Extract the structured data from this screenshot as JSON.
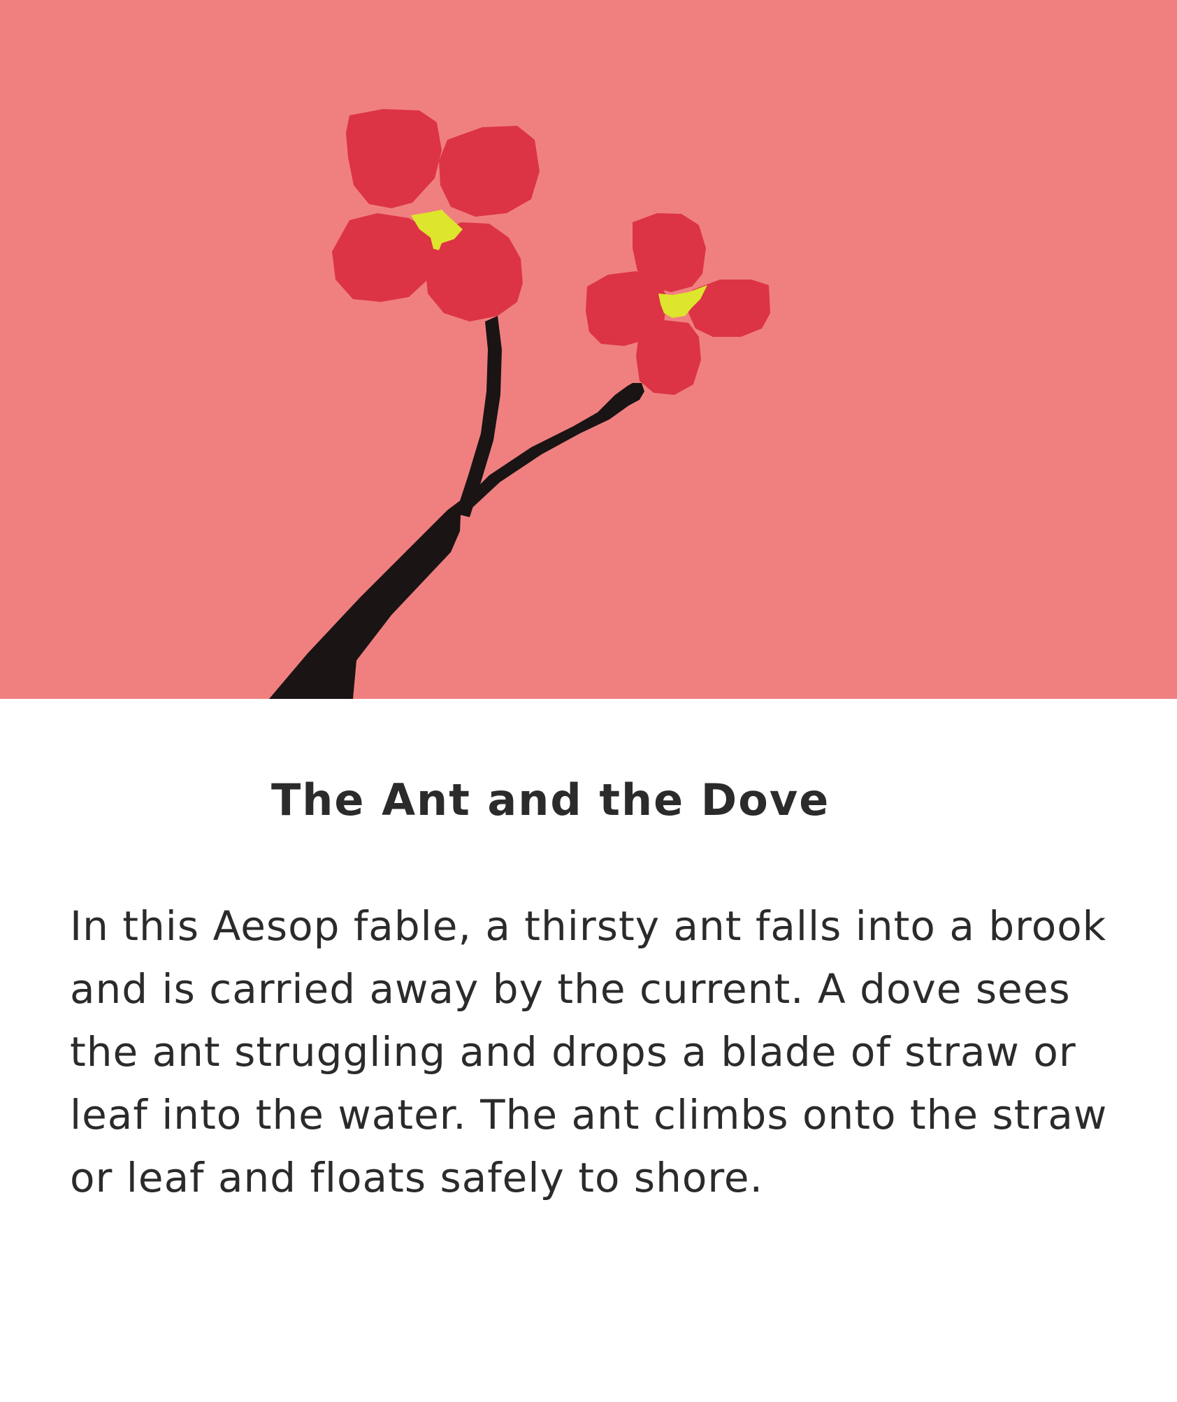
{
  "page": {
    "background_color": "#ffffff",
    "text_color": "#2b2b2b"
  },
  "illustration": {
    "background_color": "#f08080",
    "petal_color": "#dc3444",
    "center_color": "#dde52c",
    "stem_color": "#1a1414"
  },
  "story": {
    "title": "The Ant and the Dove",
    "paragraph": "In this Aesop fable, a thirsty ant falls into a brook and is carried away by the current. A dove sees the ant struggling and drops a blade of straw or leaf into the water. The ant climbs onto the straw or leaf and floats safely to shore."
  }
}
